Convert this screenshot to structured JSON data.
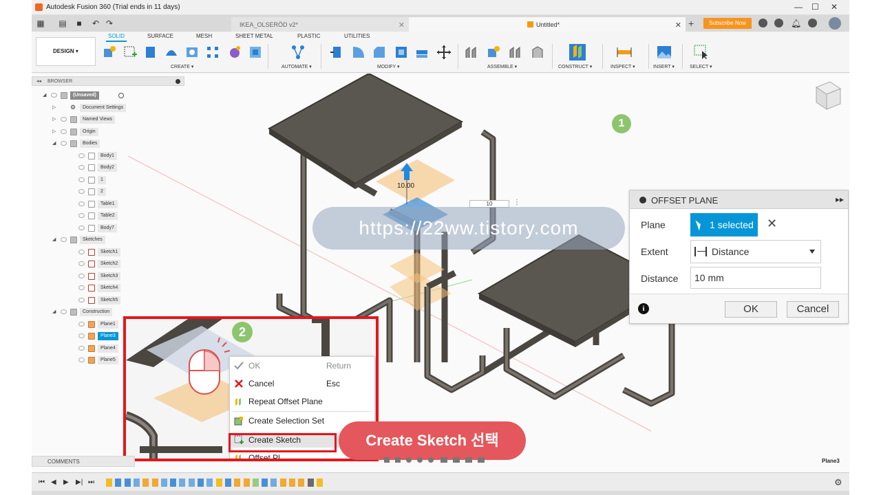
{
  "app": {
    "title": "Autodesk Fusion 360 (Trial ends in 11 days)",
    "tabs": [
      {
        "label": "IKEA_OLSERÖD v2*"
      },
      {
        "label": "Untitled*"
      }
    ],
    "subscribe_label": "Subscribe Now"
  },
  "ribbon": {
    "design_label": "DESIGN ▾",
    "tabs": [
      "SOLID",
      "SURFACE",
      "MESH",
      "SHEET METAL",
      "PLASTIC",
      "UTILITIES"
    ],
    "groups": [
      "CREATE ▾",
      "AUTOMATE ▾",
      "MODIFY ▾",
      "ASSEMBLE ▾",
      "CONSTRUCT ▾",
      "INSPECT ▾",
      "INSERT ▾",
      "SELECT ▾"
    ]
  },
  "browser": {
    "title": "BROWSER",
    "items": [
      {
        "label": "(Unsaved)",
        "level": 0
      },
      {
        "label": "Document Settings",
        "level": 1
      },
      {
        "label": "Named Views",
        "level": 1
      },
      {
        "label": "Origin",
        "level": 1
      },
      {
        "label": "Bodies",
        "level": 1
      },
      {
        "label": "Body1",
        "level": 2
      },
      {
        "label": "Body2",
        "level": 2
      },
      {
        "label": "1",
        "level": 2
      },
      {
        "label": "2",
        "level": 2
      },
      {
        "label": "Table1",
        "level": 2
      },
      {
        "label": "Table2",
        "level": 2
      },
      {
        "label": "Body7",
        "level": 2
      },
      {
        "label": "Sketches",
        "level": 1
      },
      {
        "label": "Sketch1",
        "level": 2
      },
      {
        "label": "Sketch2",
        "level": 2
      },
      {
        "label": "Sketch3",
        "level": 2
      },
      {
        "label": "Sketch4",
        "level": 2
      },
      {
        "label": "Sketch5",
        "level": 2
      },
      {
        "label": "Construction",
        "level": 1
      },
      {
        "label": "Plane1",
        "level": 2
      },
      {
        "label": "Plane3",
        "level": 2
      },
      {
        "label": "Plane4",
        "level": 2
      },
      {
        "label": "Plane5",
        "level": 2
      }
    ]
  },
  "viewport": {
    "dimension_label": "10.00",
    "dimension_input": "10",
    "status_label": "Plane3"
  },
  "dialog": {
    "title": "OFFSET PLANE",
    "plane_label": "Plane",
    "plane_value": "1 selected",
    "extent_label": "Extent",
    "extent_value": "Distance",
    "distance_label": "Distance",
    "distance_value": "10 mm",
    "ok_label": "OK",
    "cancel_label": "Cancel"
  },
  "context_menu": {
    "items": [
      {
        "label": "OK",
        "shortcut": "Return"
      },
      {
        "label": "Cancel",
        "shortcut": "Esc"
      },
      {
        "label": "Repeat Offset Plane",
        "shortcut": ""
      },
      {
        "label": "Create Selection Set",
        "shortcut": ""
      },
      {
        "label": "Create Sketch",
        "shortcut": ""
      },
      {
        "label": "Offset Pl...",
        "shortcut": ""
      }
    ]
  },
  "annotations": {
    "badge1": "1",
    "badge2": "2",
    "watermark": "https://22ww.tistory.com",
    "callout": "Create Sketch 선택"
  },
  "comments_label": "COMMENTS",
  "colors": {
    "accent_blue": "#0696d7",
    "highlight_red": "#e4161c",
    "callout_red": "#e4575c",
    "badge_green": "#8dc56e",
    "subscribe_orange": "#f7941d",
    "plane_orange": "#f5c27a",
    "body_dark": "#5a5650"
  },
  "icons": [
    "close-icon",
    "minimize-icon",
    "maximize-icon",
    "grid-icon",
    "save-icon",
    "undo-icon",
    "redo-icon",
    "eye-icon",
    "folder-icon",
    "sketch-icon",
    "plane-icon",
    "cursor-icon",
    "clear-icon",
    "distance-icon",
    "info-icon",
    "checkmark-icon",
    "cancel-x-icon",
    "repeat-icon",
    "selection-set-icon",
    "create-sketch-icon",
    "mouse-icon",
    "gear-icon",
    "view-cube-icon"
  ]
}
